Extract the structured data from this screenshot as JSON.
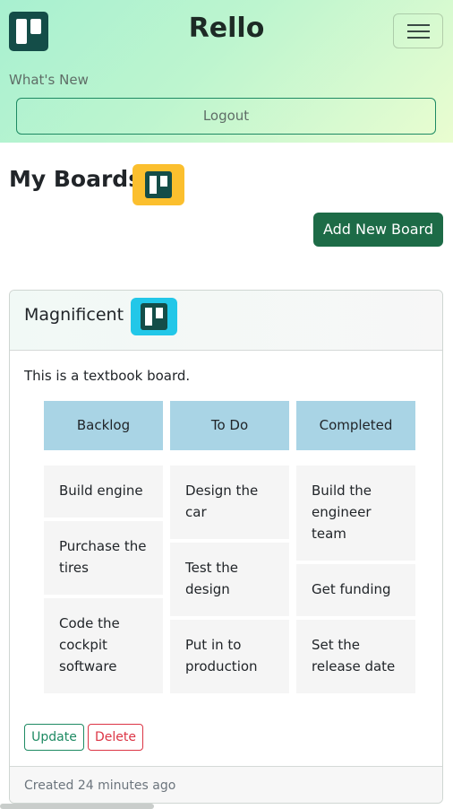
{
  "app": {
    "title": "Rello"
  },
  "nav": {
    "whats_new": "What's New",
    "logout": "Logout"
  },
  "page": {
    "section_title": "My Boards",
    "add_board": "Add New Board"
  },
  "board": {
    "name": "Magnificent",
    "description": "This is a textbook board.",
    "columns": [
      {
        "title": "Backlog",
        "cards": [
          "Build engine",
          "Purchase the tires",
          "Code the cockpit software"
        ]
      },
      {
        "title": "To Do",
        "cards": [
          "Design the car",
          "Test the design",
          "Put in to production"
        ]
      },
      {
        "title": "Completed",
        "cards": [
          "Build the engineer team",
          "Get funding",
          "Set the release date"
        ]
      }
    ],
    "actions": {
      "update": "Update",
      "delete": "Delete"
    },
    "created": "Created 24 minutes ago"
  },
  "icons": {
    "brand": "trello-logo-icon",
    "menu": "hamburger-menu-icon",
    "boards": "trello-board-icon"
  },
  "colors": {
    "primary": "#1d6b47",
    "outline_success": "#1e8a63",
    "danger": "#dc3545",
    "column_header": "#a9d4e5",
    "boards_icon_bg": "#fbbf2e",
    "board_icon_bg": "#22c7e8"
  }
}
